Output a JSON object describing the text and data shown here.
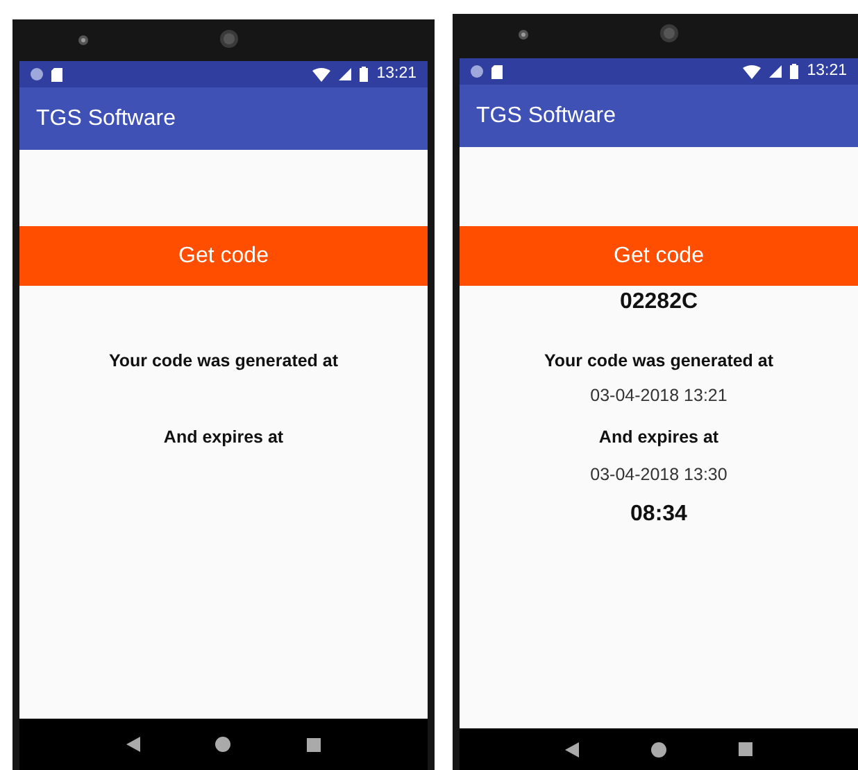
{
  "phones": [
    {
      "status_time": "13:21",
      "app_title": "TGS Software",
      "button": "Get code",
      "generated_label": "Your code was generated at",
      "expires_label": "And expires at"
    },
    {
      "status_time": "13:21",
      "app_title": "TGS Software",
      "button": "Get code",
      "code": "02282C",
      "generated_label": "Your code was generated at",
      "generated_at": "03-04-2018 13:21",
      "expires_label": "And expires at",
      "expires_at": "03-04-2018 13:30",
      "countdown": "08:34"
    }
  ]
}
